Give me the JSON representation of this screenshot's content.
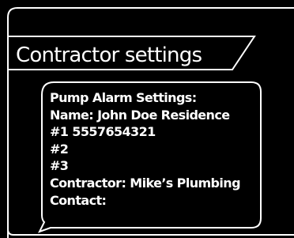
{
  "header": {
    "title": "Contractor settings"
  },
  "message": {
    "lines": [
      "Pump Alarm Settings:",
      "Name: John Doe Residence",
      "#1 5557654321",
      "#2",
      "#3",
      "Contractor: Mike’s Plumbing",
      "Contact:"
    ]
  },
  "colors": {
    "background": "#000000",
    "foreground": "#ffffff"
  }
}
